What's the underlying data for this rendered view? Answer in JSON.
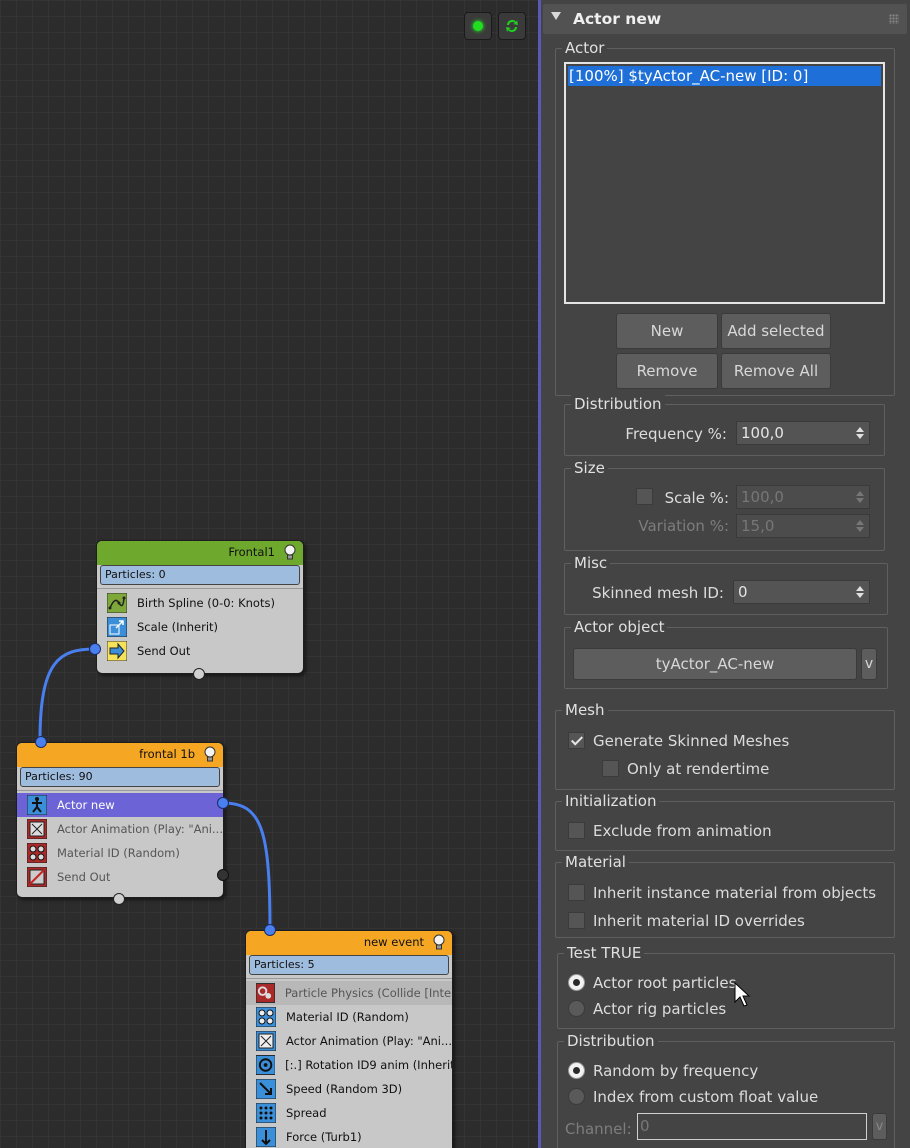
{
  "canvas": {
    "top_buttons": [
      {
        "icon": "green-dot-icon",
        "color": "#22dd22"
      },
      {
        "icon": "refresh-icon",
        "color": "#22cc22"
      }
    ],
    "nodes": {
      "frontal1": {
        "title": "Frontal1",
        "header_color": "#6ea82c",
        "particles": "Particles: 0",
        "operators": [
          {
            "label": "Birth Spline (0-0: Knots)",
            "icon": "birth-spline-icon"
          },
          {
            "label": "Scale (Inherit)",
            "icon": "scale-icon"
          },
          {
            "label": "Send Out",
            "icon": "send-out-icon"
          }
        ]
      },
      "frontal1b": {
        "title": "frontal 1b",
        "header_color": "#f5a623",
        "particles": "Particles: 90",
        "operators": [
          {
            "label": "Actor new",
            "icon": "actor-icon",
            "selected": true
          },
          {
            "label": "Actor Animation (Play: \"Ani...",
            "icon": "actor-animation-icon",
            "disabled": true
          },
          {
            "label": "Material ID (Random)",
            "icon": "material-id-icon",
            "disabled": true
          },
          {
            "label": "Send Out",
            "icon": "send-out-icon",
            "disabled": true
          }
        ]
      },
      "new_event": {
        "title": "new event",
        "header_color": "#f5a623",
        "particles": "Particles: 5",
        "operators": [
          {
            "label": "Particle Physics (Collide [Inte...",
            "icon": "particle-physics-icon",
            "disabled": true
          },
          {
            "label": "Material ID (Random)",
            "icon": "material-id-icon"
          },
          {
            "label": "Actor Animation (Play: \"Ani...",
            "icon": "actor-animation-icon"
          },
          {
            "label": "[:.] Rotation ID9 anim (Inherit)",
            "icon": "rotation-icon"
          },
          {
            "label": "Speed (Random 3D)",
            "icon": "speed-icon"
          },
          {
            "label": "Spread",
            "icon": "spread-icon"
          },
          {
            "label": "Force (Turb1)",
            "icon": "force-icon"
          }
        ]
      }
    }
  },
  "panel": {
    "rollout_title": "Actor new",
    "actor_group": {
      "title": "Actor",
      "list_items": [
        "[100%] $tyActor_AC-new [ID: 0]"
      ],
      "buttons": {
        "new": "New",
        "add_selected": "Add selected",
        "remove": "Remove",
        "remove_all": "Remove All"
      }
    },
    "distribution": {
      "title": "Distribution",
      "frequency_label": "Frequency %:",
      "frequency_value": "100,0"
    },
    "size": {
      "title": "Size",
      "scale_label": "Scale %:",
      "scale_value": "100,0",
      "variation_label": "Variation %:",
      "variation_value": "15,0"
    },
    "misc": {
      "title": "Misc",
      "skinned_label": "Skinned mesh ID:",
      "skinned_value": "0"
    },
    "actor_object": {
      "title": "Actor object",
      "button": "tyActor_AC-new",
      "dropdown": "v"
    },
    "mesh": {
      "title": "Mesh",
      "generate_label": "Generate Skinned Meshes",
      "generate_checked": true,
      "rendertime_label": "Only at rendertime",
      "rendertime_checked": false
    },
    "initialization": {
      "title": "Initialization",
      "exclude_label": "Exclude from animation",
      "exclude_checked": false
    },
    "material": {
      "title": "Material",
      "inherit_instance_label": "Inherit instance material from objects",
      "inherit_overrides_label": "Inherit material ID overrides"
    },
    "test_true": {
      "title": "Test TRUE",
      "root_label": "Actor root particles",
      "rig_label": "Actor rig particles",
      "selected": "root"
    },
    "distribution2": {
      "title": "Distribution",
      "random_label": "Random by frequency",
      "index_label": "Index from custom float value",
      "selected": "random",
      "channel_label": "Channel:",
      "channel_value": "0",
      "dropdown": "v"
    }
  }
}
